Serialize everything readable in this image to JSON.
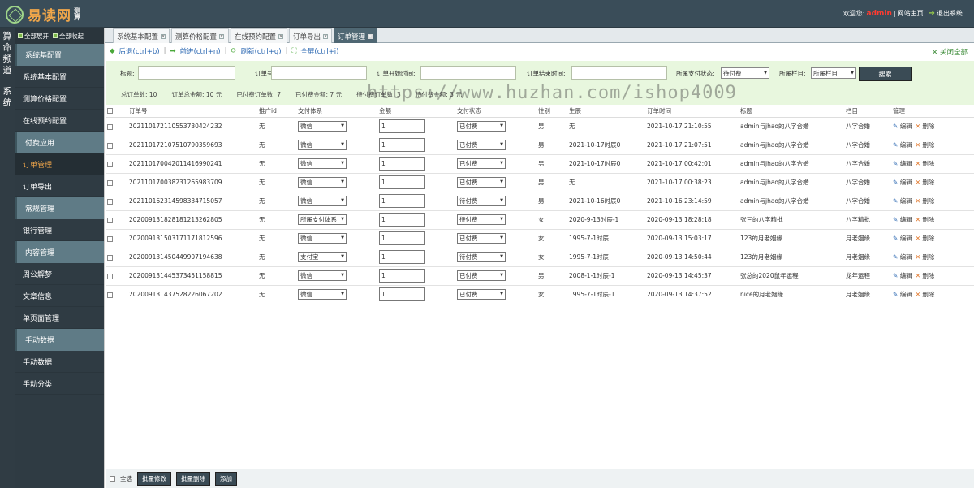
{
  "header": {
    "logo_text": "易读网",
    "logo_sub": "测算",
    "welcome": "欢迎您:",
    "user": "admin",
    "links_sep": "|",
    "site_home": "网站主页",
    "logout": "退出系统"
  },
  "leftstrip": {
    "labels": [
      "算",
      "命",
      "频",
      "道",
      "系",
      "统"
    ]
  },
  "sidebar": {
    "expand_all": "全部展开",
    "collapse_all": "全部收起",
    "groups": [
      {
        "label": "系统基配置",
        "items": [
          "系统基本配置",
          "测算价格配置",
          "在线预约配置"
        ]
      },
      {
        "label": "付费应用",
        "items": [
          "订单管理",
          "订单导出"
        ]
      },
      {
        "label": "常规管理",
        "items": [
          "银行管理"
        ]
      },
      {
        "label": "内容管理",
        "items": [
          "周公解梦",
          "文章信息",
          "单页面管理"
        ]
      },
      {
        "label": "手动数据",
        "items": [
          "手动数据",
          "手动分类"
        ]
      }
    ],
    "active_item": "订单管理"
  },
  "tabs": [
    "系统基本配置",
    "测算价格配置",
    "在线预约配置",
    "订单导出",
    "订单管理"
  ],
  "active_tab": "订单管理",
  "navbar": {
    "back": "后退(ctrl+b)",
    "forward": "前进(ctrl+n)",
    "refresh": "刷新(ctrl+q)",
    "fullscreen": "全屏(ctrl+i)",
    "close_all": "关闭全部"
  },
  "filter": {
    "title_label": "标题:",
    "order_no_label": "订单号:",
    "start_label": "订单开始时间:",
    "end_label": "订单结束时间:",
    "pay_status_label": "所属支付状态:",
    "pay_status_value": "待付费",
    "column_label": "所属栏目:",
    "column_value": "所属栏目",
    "search_button": "搜索"
  },
  "stats": {
    "total_orders": "总订单数: 10",
    "total_amount": "订单总金额: 10 元",
    "paid_orders": "已付费订单数: 7",
    "paid_amount": "已付费金额: 7 元",
    "unpaid_orders": "待付费订单数: 3",
    "unpaid_amount": "待付费金额: 3 元"
  },
  "watermark": "https://www.huzhan.com/ishop4009",
  "table": {
    "columns": [
      "订单号",
      "推广id",
      "支付体系",
      "金额",
      "支付状态",
      "性别",
      "生辰",
      "订单时间",
      "标题",
      "栏目",
      "管理"
    ],
    "edit_label": "编辑",
    "delete_label": "删除",
    "rows": [
      {
        "order_no": "202110172110553730424232",
        "promo": "无",
        "pay_system": "微信",
        "amount": "1",
        "status": "已付费",
        "gender": "男",
        "birth": "无",
        "time": "2021-10-17 21:10:55",
        "title": "admin与jhao的八字合婚",
        "column": "八字合婚"
      },
      {
        "order_no": "202110172107510790359693",
        "promo": "无",
        "pay_system": "微信",
        "amount": "1",
        "status": "已付费",
        "gender": "男",
        "birth": "2021-10-17时辰0",
        "time": "2021-10-17 21:07:51",
        "title": "admin与jhao的八字合婚",
        "column": "八字合婚"
      },
      {
        "order_no": "202110170042011416990241",
        "promo": "无",
        "pay_system": "微信",
        "amount": "1",
        "status": "已付费",
        "gender": "男",
        "birth": "2021-10-17时辰0",
        "time": "2021-10-17 00:42:01",
        "title": "admin与jhao的八字合婚",
        "column": "八字合婚"
      },
      {
        "order_no": "202110170038231265983709",
        "promo": "无",
        "pay_system": "微信",
        "amount": "1",
        "status": "已付费",
        "gender": "男",
        "birth": "无",
        "time": "2021-10-17 00:38:23",
        "title": "admin与jhao的八字合婚",
        "column": "八字合婚"
      },
      {
        "order_no": "202110162314598334715057",
        "promo": "无",
        "pay_system": "微信",
        "amount": "1",
        "status": "待付费",
        "gender": "男",
        "birth": "2021-10-16时辰0",
        "time": "2021-10-16 23:14:59",
        "title": "admin与jhao的八字合婚",
        "column": "八字合婚"
      },
      {
        "order_no": "202009131828181213262805",
        "promo": "无",
        "pay_system": "所属支付体系",
        "amount": "1",
        "status": "待付费",
        "gender": "女",
        "birth": "2020-9-13时辰-1",
        "time": "2020-09-13 18:28:18",
        "title": "张三的八字精批",
        "column": "八字精批"
      },
      {
        "order_no": "202009131503171171812596",
        "promo": "无",
        "pay_system": "微信",
        "amount": "1",
        "status": "已付费",
        "gender": "女",
        "birth": "1995-7-1时辰",
        "time": "2020-09-13 15:03:17",
        "title": "123的月老姻缘",
        "column": "月老姻缘"
      },
      {
        "order_no": "202009131450449907194638",
        "promo": "无",
        "pay_system": "支付宝",
        "amount": "1",
        "status": "待付费",
        "gender": "女",
        "birth": "1995-7-1时辰",
        "time": "2020-09-13 14:50:44",
        "title": "123的月老姻缘",
        "column": "月老姻缘"
      },
      {
        "order_no": "202009131445373451158815",
        "promo": "无",
        "pay_system": "微信",
        "amount": "1",
        "status": "已付费",
        "gender": "男",
        "birth": "2008-1-1时辰-1",
        "time": "2020-09-13 14:45:37",
        "title": "张总的2020鼠年运程",
        "column": "龙年运程"
      },
      {
        "order_no": "202009131437528226067202",
        "promo": "无",
        "pay_system": "微信",
        "amount": "1",
        "status": "已付费",
        "gender": "女",
        "birth": "1995-7-1时辰-1",
        "time": "2020-09-13 14:37:52",
        "title": "nice的月老姻缘",
        "column": "月老姻缘"
      }
    ]
  },
  "footer": {
    "select_all": "全选",
    "batch_edit": "批量修改",
    "batch_delete": "批量删除",
    "add": "添加"
  },
  "colors": {
    "header_bg": "#3a4d59",
    "sidebar_bg": "#2f3b43",
    "group_bg": "#5f7b86",
    "accent_orange": "#f0a64a",
    "filter_bg": "#e8f7de",
    "admin_red": "#ff3b30"
  }
}
